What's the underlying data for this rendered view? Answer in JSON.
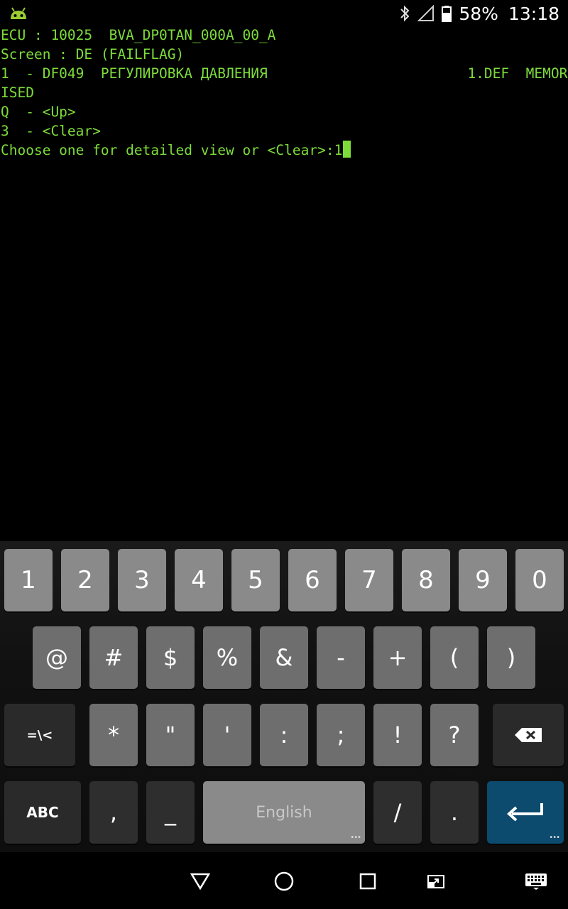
{
  "status_bar": {
    "battery": "58%",
    "time": "13:18",
    "icons": [
      "android-app-icon",
      "bluetooth-icon",
      "signal-icon",
      "battery-icon"
    ]
  },
  "terminal": {
    "lines": [
      "ECU : 10025  BVA_DP0TAN_000A_00_A",
      "Screen : DE (FAILFLAG)",
      "1  - DF049  РЕГУЛИРОВКА ДАВЛЕНИЯ                        1.DEF  MEMOR",
      "ISED",
      "Q  - <Up>",
      "3  - <Clear>",
      "Choose one for detailed view or <Clear>:1"
    ],
    "text_color": "#7ddc3a"
  },
  "keyboard": {
    "row1": [
      "1",
      "2",
      "3",
      "4",
      "5",
      "6",
      "7",
      "8",
      "9",
      "0"
    ],
    "row2": [
      "@",
      "#",
      "$",
      "%",
      "&",
      "-",
      "+",
      "(",
      ")"
    ],
    "row3": [
      "=\\<",
      "*",
      "\"",
      "'",
      ":",
      ";",
      "!",
      "?"
    ],
    "row4": {
      "abc": "ABC",
      "comma": ",",
      "underscore": "_",
      "space": "English",
      "slash": "/",
      "period": "."
    },
    "enter_color": "#0c4a6e"
  },
  "nav_bar": {
    "icons": [
      "back-icon",
      "home-icon",
      "recents-icon",
      "screen-toggle-icon",
      "keyboard-switch-icon"
    ]
  }
}
